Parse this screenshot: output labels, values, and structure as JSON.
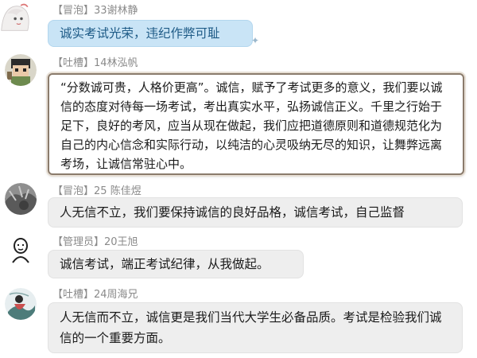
{
  "messages": [
    {
      "tag": "【冒泡】",
      "sender": "33谢林静",
      "text": "诚实考试光荣，违纪作弊可耻",
      "avatar": "anime-girl-avatar-icon"
    },
    {
      "tag": "【吐槽】",
      "sender": "14林泓帆",
      "text": "“分数诚可贵，人格价更高”。诚信，赋予了考试更多的意义，我们要以诚信的态度对待每一场考试，考出真实水平，弘扬诚信正义。千里之行始于足下，良好的考风，应当从现在做起，我们应把道德原则和道德规范化为自己的内心信念和实际行动，以纯洁的心灵吸纳无尽的知识，让舞弊远离考场，让诚信常驻心中。",
      "avatar": "pixel-character-avatar-icon"
    },
    {
      "tag": "【冒泡】",
      "sender": "25 陈佳煜",
      "text": "人无信不立，我们要保持诚信的良好品格，诚信考试，自己监督",
      "avatar": "gray-photo-avatar-icon"
    },
    {
      "tag": "【管理员】",
      "sender": "20王旭",
      "text": "诚信考试，端正考试纪律，从我做起。",
      "avatar": "sketch-face-avatar-icon"
    },
    {
      "tag": "【吐槽】",
      "sender": "24周海兄",
      "text": "人无信而不立，诚信更是我们当代大学生必备品质。考试是检验我们诚信的一个重要方面。",
      "avatar": "ink-painting-avatar-icon"
    }
  ],
  "colors": {
    "blue_bubble": "#c9e4f6",
    "gray_bubble": "#eeeeee",
    "meta_text": "#8a8a8a"
  }
}
